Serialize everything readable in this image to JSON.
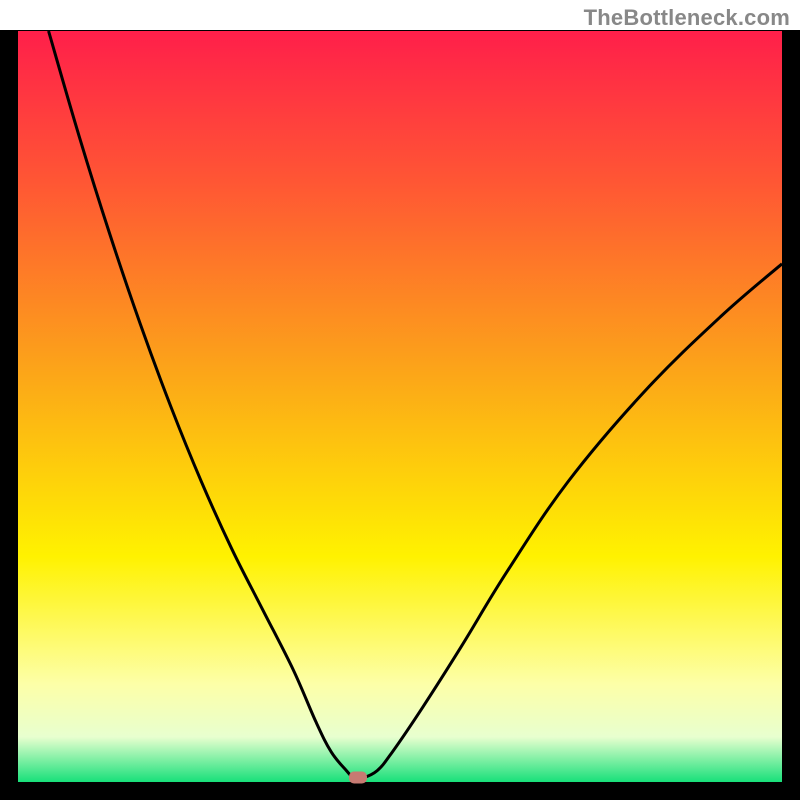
{
  "watermark": "TheBottleneck.com",
  "chart_data": {
    "type": "line",
    "title": "",
    "xlabel": "",
    "ylabel": "",
    "xlim": [
      0,
      100
    ],
    "ylim": [
      0,
      100
    ],
    "series": [
      {
        "name": "curve",
        "x": [
          4,
          8,
          12,
          16,
          20,
          24,
          28,
          32,
          36,
          39,
          41,
          43,
          44,
          45,
          47,
          49,
          53,
          58,
          64,
          72,
          82,
          92,
          100
        ],
        "y": [
          100,
          86,
          73,
          61,
          50,
          40,
          31,
          23,
          15,
          8,
          4,
          1.5,
          0.5,
          0.5,
          1.5,
          4,
          10,
          18,
          28,
          40,
          52,
          62,
          69
        ]
      }
    ],
    "markers": [
      {
        "name": "minimum",
        "x": 44.5,
        "y": 0.6,
        "color": "#c77a72"
      }
    ],
    "background_gradient_stops": [
      {
        "offset": 0,
        "color": "#ff1f4a"
      },
      {
        "offset": 20,
        "color": "#ff5634"
      },
      {
        "offset": 45,
        "color": "#fca419"
      },
      {
        "offset": 70,
        "color": "#fff200"
      },
      {
        "offset": 87,
        "color": "#fdffa8"
      },
      {
        "offset": 94,
        "color": "#e8ffcf"
      },
      {
        "offset": 100,
        "color": "#18e07a"
      }
    ],
    "frame_color": "#000000",
    "curve_color": "#000000"
  }
}
